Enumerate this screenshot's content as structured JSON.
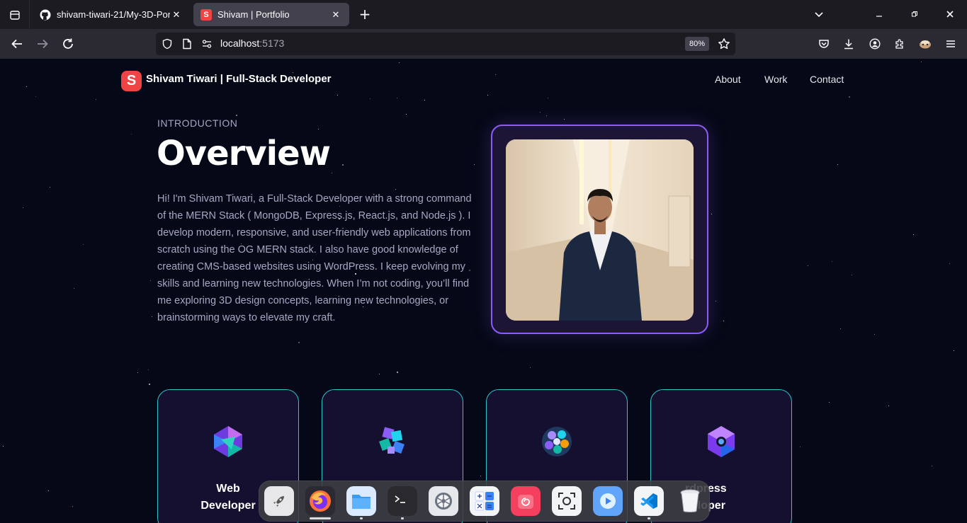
{
  "browser": {
    "tabs": [
      {
        "title": "shivam-tiwari-21/My-3D-Portf",
        "icon": "github-icon",
        "active": false
      },
      {
        "title": "Shivam | Portfolio",
        "icon": "portfolio-favicon",
        "favicon_letter": "S",
        "active": true
      }
    ],
    "new_tab_label": "+",
    "url_host": "localhost",
    "url_port": ":5173",
    "zoom": "80%"
  },
  "site": {
    "logo_letter": "S",
    "name": "Shivam Tiwari | Full-Stack Developer",
    "nav": [
      "About",
      "Work",
      "Contact"
    ],
    "accent": "#915eff",
    "card_border": "#31c4c8"
  },
  "overview": {
    "subtitle": "INTRODUCTION",
    "title": "Overview",
    "bio": "Hi! I'm Shivam Tiwari, a Full-Stack Developer with a strong command of the MERN Stack ( MongoDB, Express.js, React.js, and Node.js ). I develop modern, responsive, and user-friendly web applications from scratch using the OG MERN stack. I also have good knowledge of creating CMS-based websites using WordPress. I keep evolving my skills and learning new technologies. When I’m not coding, you’ll find me exploring 3D design concepts, learning new technologies, or brainstorming ways to elevate my craft."
  },
  "services": [
    {
      "title": "Web Developer",
      "icon": "web-icon"
    },
    {
      "title": "",
      "icon": "backend-icon"
    },
    {
      "title": "",
      "icon": "creator-icon"
    },
    {
      "title": "Wordpress Developer",
      "visible_text": "rdpress veloper",
      "icon": "wordpress-icon"
    }
  ],
  "dock": {
    "apps": [
      "launcher",
      "firefox",
      "files",
      "terminal",
      "settings",
      "calculator",
      "debian",
      "screenshot",
      "video-player",
      "vscode",
      "trash"
    ]
  }
}
